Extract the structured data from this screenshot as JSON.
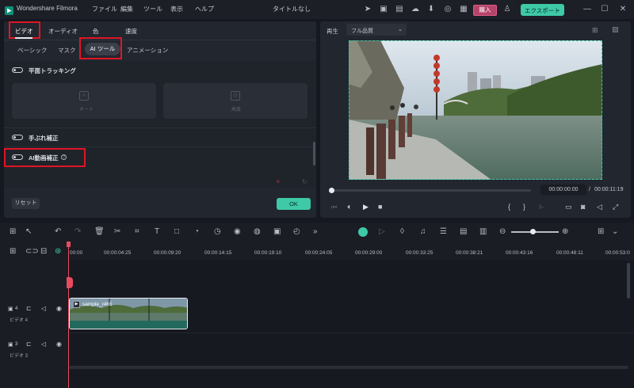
{
  "app": {
    "name": "Wondershare Filmora",
    "menu": [
      "ファイル",
      "編集",
      "ツール",
      "表示",
      "ヘルプ"
    ],
    "document_title": "タイトルなし",
    "buy_label": "購入",
    "export_label": "エクスポート"
  },
  "property_panel": {
    "top_tabs": [
      "ビデオ",
      "オーディオ",
      "色",
      "速度"
    ],
    "sub_tabs": [
      "ベーシック",
      "マスク",
      "AI ツール",
      "アニメーション"
    ],
    "options": {
      "plane_tracking": "平面トラッキング",
      "auto_label": "オート",
      "advanced_label": "高度",
      "stabilization": "手ぶれ補正",
      "ai_video_enhance": "AI動画補正"
    },
    "reset_label": "リセット",
    "ok_label": "OK"
  },
  "preview": {
    "play_label": "再生",
    "quality_label": "フル品質",
    "current_time": "00:00:00:00",
    "separator": "/",
    "total_time": "00:00:11:19"
  },
  "timeline": {
    "ruler_ticks": [
      "00:00",
      "00:00:04:25",
      "00:00:09:20",
      "00:00:14:15",
      "00:00:19:10",
      "00:00:24:05",
      "00:00:29:00",
      "00:00:33:25",
      "00:00:38:21",
      "00:00:43:16",
      "00:00:48:11",
      "00:00:53:0"
    ],
    "tracks": [
      {
        "number": "4",
        "name": "ビデオ 4"
      },
      {
        "number": "3",
        "name": "ビデオ 3"
      }
    ],
    "clip_label": "sample_r4h5",
    "playhead_time_fraction": 0.0
  },
  "colors": {
    "accent": "#3ec9a7",
    "highlight": "#e01525",
    "buy": "#b5446b",
    "playhead": "#e84a5f"
  }
}
